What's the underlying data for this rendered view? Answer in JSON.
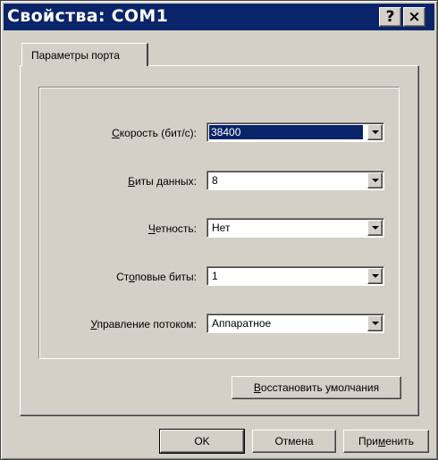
{
  "window": {
    "title": "Свойства: COM1",
    "help_label": "?",
    "close_label": "×"
  },
  "tab": {
    "label": "Параметры порта"
  },
  "fields": [
    {
      "label_u": "С",
      "label_rest": "корость (бит/с):",
      "value": "38400"
    },
    {
      "label_u": "Б",
      "label_rest": "иты данных:",
      "value": "8"
    },
    {
      "label_u": "Ч",
      "label_rest": "етность:",
      "value": "Нет"
    },
    {
      "label_pre": "Ст",
      "label_u": "о",
      "label_rest": "повые биты:",
      "value": "1"
    },
    {
      "label_u": "У",
      "label_rest": "правление потоком:",
      "value": "Аппаратное"
    }
  ],
  "restore": {
    "label_u": "В",
    "label_rest": "осстановить умолчания"
  },
  "buttons": {
    "ok": "OK",
    "cancel": "Отмена",
    "apply_pre": "При",
    "apply_u": "м",
    "apply_rest": "енить"
  }
}
